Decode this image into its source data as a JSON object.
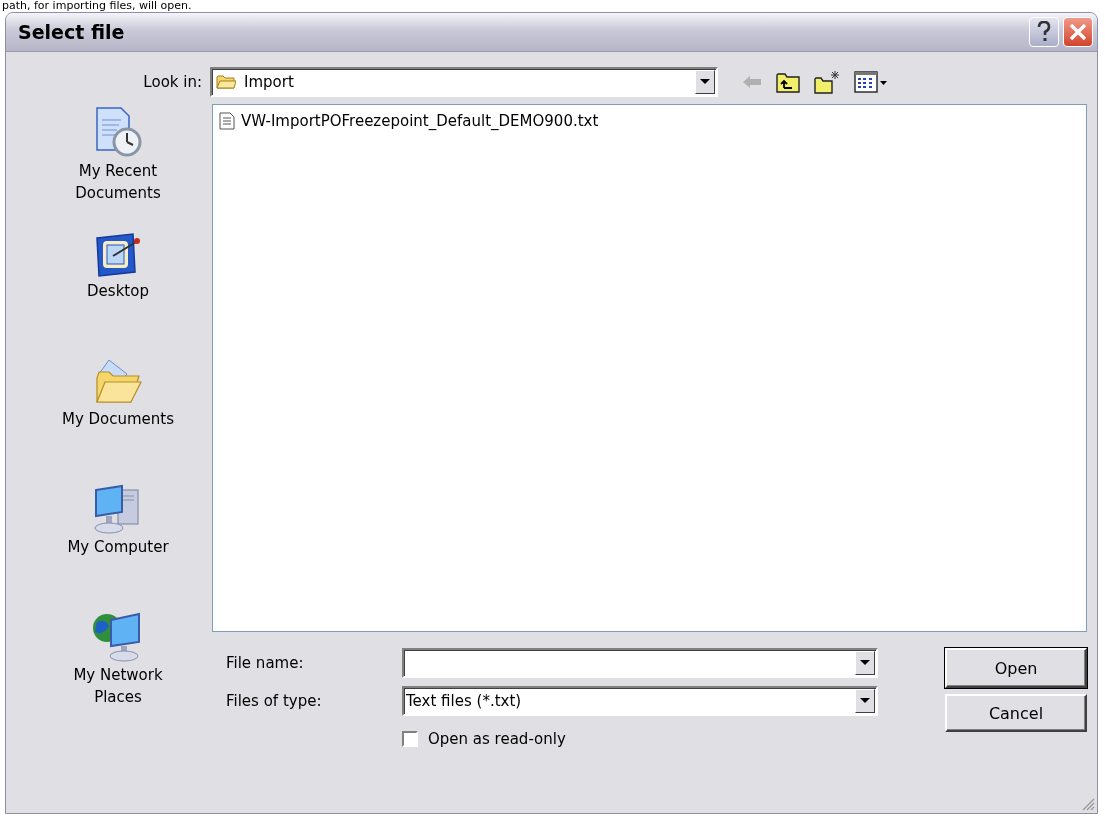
{
  "caption": "path, for importing files, will open.",
  "window": {
    "title": "Select file"
  },
  "look_in": {
    "label": "Look in:",
    "value": "Import"
  },
  "places": [
    {
      "label": "My Recent Documents",
      "kind": "recent"
    },
    {
      "label": "Desktop",
      "kind": "desktop"
    },
    {
      "label": "My Documents",
      "kind": "documents"
    },
    {
      "label": "My Computer",
      "kind": "computer"
    },
    {
      "label": "My Network Places",
      "kind": "network"
    }
  ],
  "files": [
    {
      "name": "VW-ImportPOFreezepoint_Default_DEMO900.txt",
      "selected": false
    }
  ],
  "file_name": {
    "label": "File name:"
  },
  "file_type": {
    "label": "Files of type:",
    "value": "Text files (*.txt)"
  },
  "read_only": {
    "label": "Open as read-only",
    "checked": false
  },
  "buttons": [
    {
      "label": "Open",
      "default": true
    },
    {
      "label": "Cancel",
      "default": false
    }
  ]
}
